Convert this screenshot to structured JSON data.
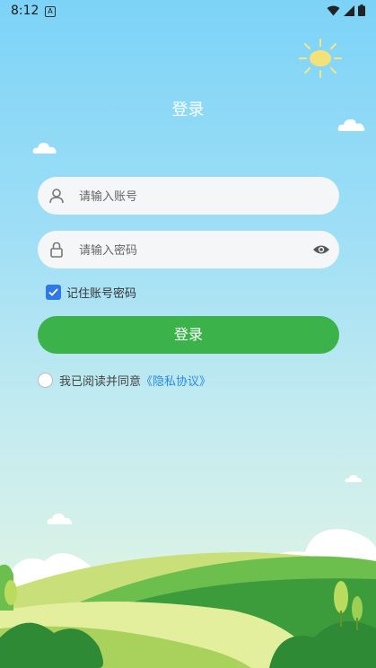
{
  "status": {
    "time": "8:12",
    "app_icon": "A"
  },
  "title": "登录",
  "username": {
    "placeholder": "请输入账号",
    "value": ""
  },
  "password": {
    "placeholder": "请输入密码",
    "value": ""
  },
  "remember": {
    "label": "记住账号密码",
    "checked": true
  },
  "login_button": "登录",
  "agreement": {
    "text": "我已阅读并同意",
    "link": "《隐私协议》",
    "checked": false
  },
  "colors": {
    "primary_green": "#3bb24a",
    "checkbox_blue": "#2f78e6",
    "link_blue": "#2a8ae6"
  }
}
